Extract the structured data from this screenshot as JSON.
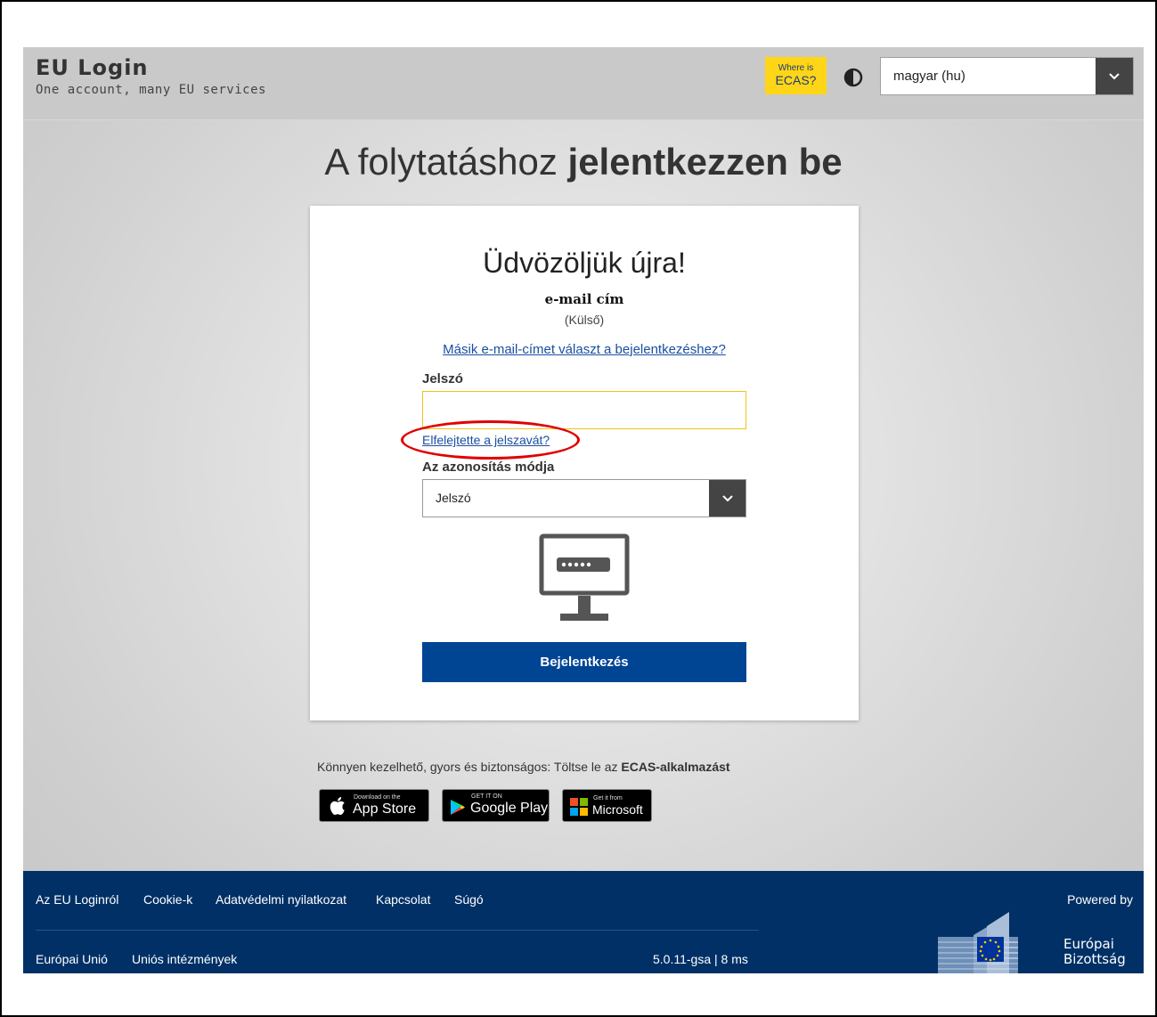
{
  "header": {
    "brand_title": "EU Login",
    "brand_subtitle": "One account, many EU services",
    "ecas_badge": {
      "line1": "Where is",
      "line2": "ECAS?"
    },
    "language": "magyar (hu)",
    "icons": [
      "contrast-icon",
      "chevron-down-icon"
    ]
  },
  "headline": {
    "normal": "A folytatáshoz ",
    "bold": "jelentkezzen be"
  },
  "card": {
    "welcome": "Üdvözöljük újra!",
    "email": "e-mail cím",
    "account_type": "(Külső)",
    "other_email_link": "Másik e-mail-címet választ a bejelentkezéshez?",
    "password_label": "Jelszó",
    "password_value": "",
    "forgot_link": "Elfelejtette a jelszavát?",
    "method_label": "Az azonosítás módja",
    "method_value": "Jelszó",
    "submit_label": "Bejelentkezés"
  },
  "promo": {
    "text": "Könnyen kezelhető, gyors és biztonságos: Töltse le az ",
    "bold": "ECAS-alkalmazást"
  },
  "stores": {
    "appstore": {
      "small": "Download on the",
      "name": "App Store"
    },
    "googleplay": {
      "small": "GET IT ON",
      "name": "Google Play"
    },
    "microsoft": {
      "small": "Get it from",
      "name": "Microsoft"
    }
  },
  "footer": {
    "links_top": [
      "Az EU Loginról",
      "Cookie-k",
      "Adatvédelmi nyilatkozat",
      "Kapcsolat",
      "Súgó"
    ],
    "links_bottom": [
      "Európai Unió",
      "Uniós intézmények"
    ],
    "version": "5.0.11-gsa | 8 ms",
    "powered_by": "Powered by",
    "ec_name_line1": "Európai",
    "ec_name_line2": "Bizottság"
  },
  "colors": {
    "accent_blue": "#004494",
    "ecas_yellow": "#ffd617",
    "footer_navy": "#003066",
    "annotation_red": "#e00000"
  }
}
